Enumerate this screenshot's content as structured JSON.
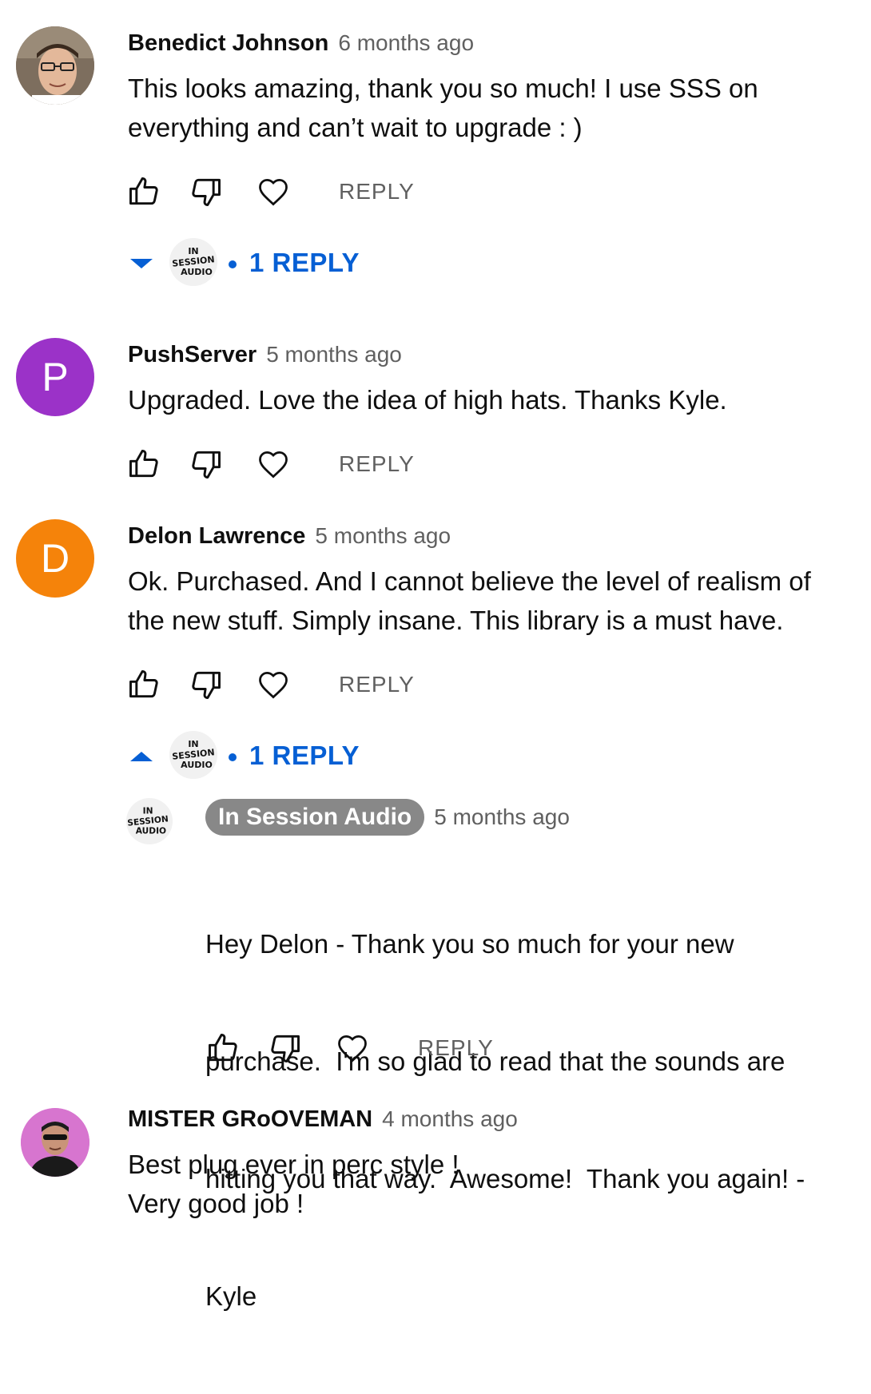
{
  "comments": [
    {
      "author": "Benedict Johnson",
      "time": "6 months ago",
      "lines": [
        "This looks amazing, thank you so much! I use SSS on",
        "everything and can’t wait to upgrade : )"
      ],
      "reply_label": "REPLY",
      "replies_toggle": "1 REPLY",
      "replies_expanded": false
    },
    {
      "author": "PushServer",
      "avatar_letter": "P",
      "avatar_color": "#9b32c8",
      "time": "5 months ago",
      "lines": [
        "Upgraded. Love the idea of high hats. Thanks Kyle."
      ],
      "reply_label": "REPLY"
    },
    {
      "author": "Delon Lawrence",
      "avatar_letter": "D",
      "avatar_color": "#f5830a",
      "time": "5 months ago",
      "lines": [
        "Ok. Purchased. And I cannot believe the level of realism of",
        "the new stuff. Simply insane. This library is a must have."
      ],
      "reply_label": "REPLY",
      "replies_toggle": "1 REPLY",
      "replies_expanded": true,
      "reply": {
        "author": "In Session Audio",
        "time": "5 months ago",
        "lines": [
          "Hey Delon - Thank you so much for your new",
          "purchase.  I'm so glad to read that the sounds are",
          "hitting you that way.  Awesome!  Thank you again! -",
          "Kyle"
        ],
        "reply_label": "REPLY"
      }
    },
    {
      "author": "MISTER GRoOVEMAN",
      "time": "4 months ago",
      "lines": [
        "Best plug ever in perc style !",
        "Very good job !"
      ]
    }
  ],
  "channel_logo": {
    "line1": "IN",
    "line2": "SESSION",
    "line3": "AUDIO"
  },
  "colors": {
    "link_blue": "#065fd4",
    "secondary_text": "#606060",
    "owner_chip": "#888888"
  },
  "icons": [
    "thumbs-up-icon",
    "thumbs-down-icon",
    "heart-icon",
    "caret-down-icon",
    "caret-up-icon"
  ]
}
